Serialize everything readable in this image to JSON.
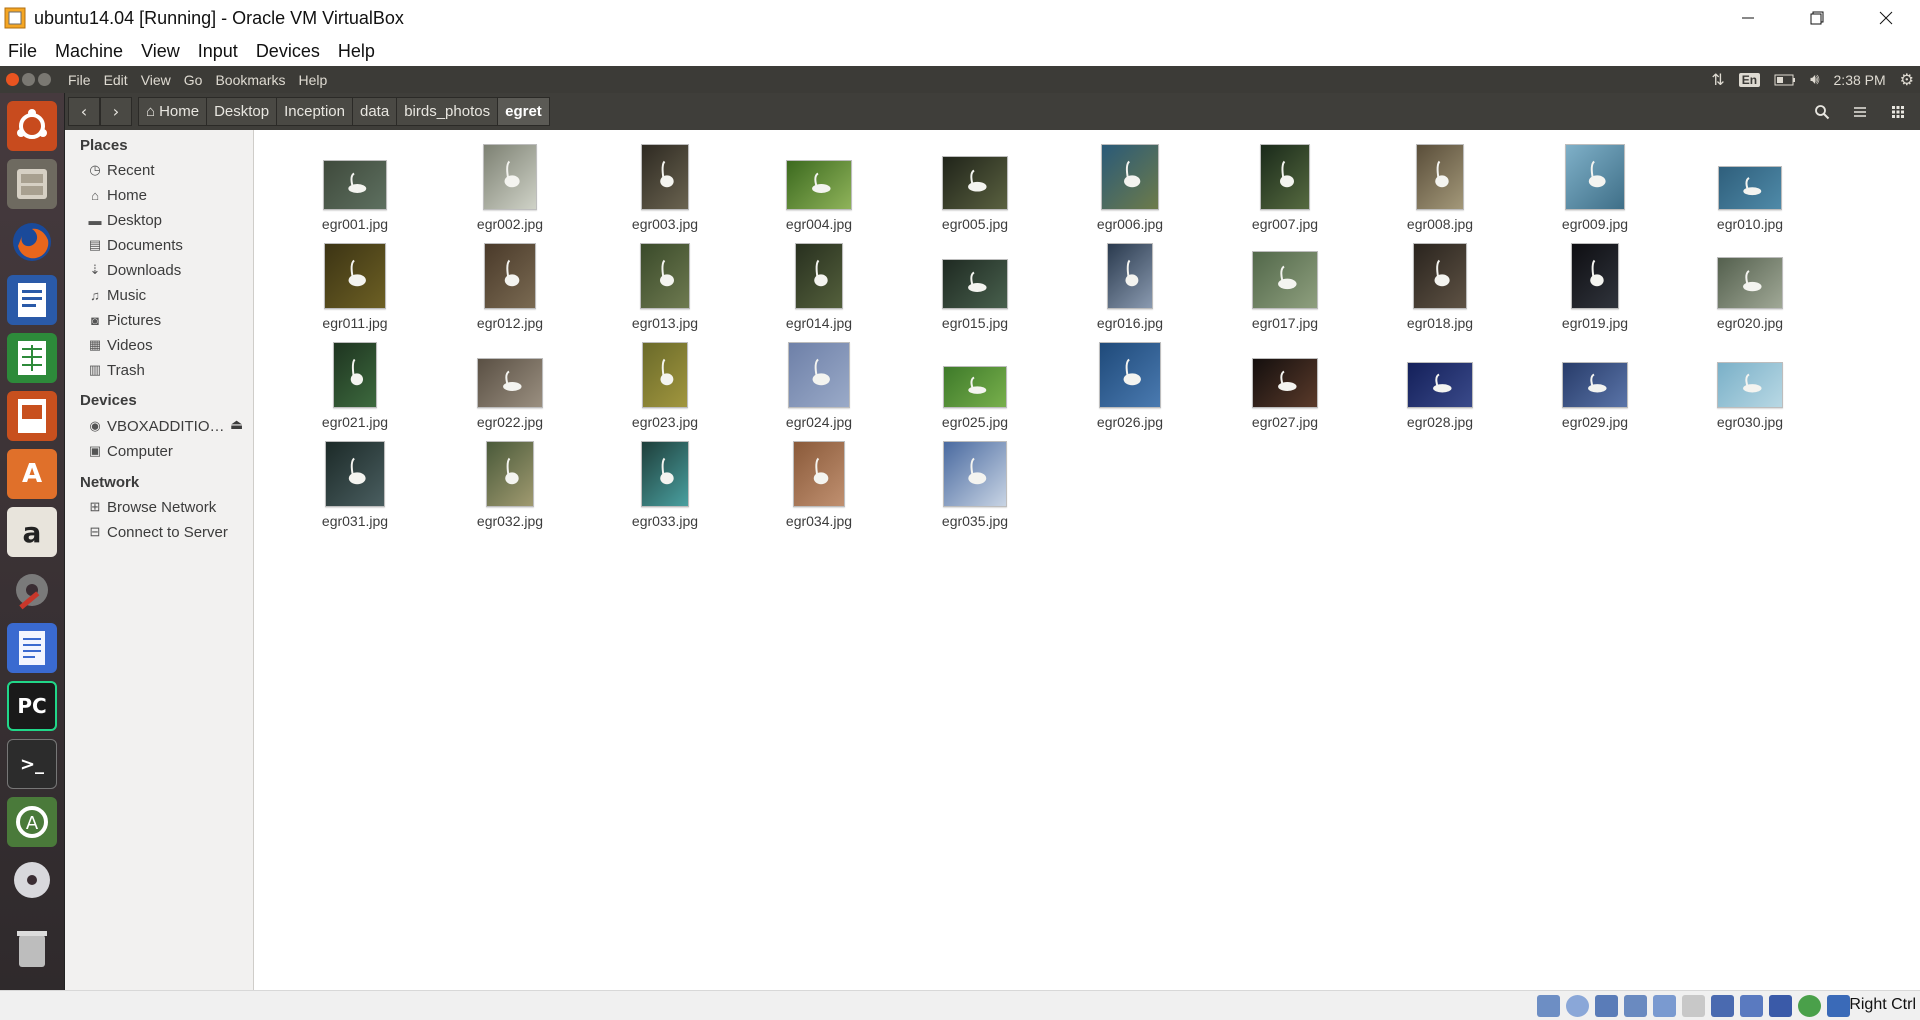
{
  "host_window": {
    "title": "ubuntu14.04 [Running] - Oracle VM VirtualBox",
    "menu": [
      "File",
      "Machine",
      "View",
      "Input",
      "Devices",
      "Help"
    ],
    "status_hostkey": "Right Ctrl"
  },
  "ubuntu_panel": {
    "menu": [
      "File",
      "Edit",
      "View",
      "Go",
      "Bookmarks",
      "Help"
    ],
    "lang": "En",
    "clock": "2:38 PM"
  },
  "breadcrumb": [
    "Home",
    "Desktop",
    "Inception",
    "data",
    "birds_photos",
    "egret"
  ],
  "sidebar": {
    "places_title": "Places",
    "places": [
      {
        "label": "Recent",
        "icon": "clock-icon"
      },
      {
        "label": "Home",
        "icon": "home-icon"
      },
      {
        "label": "Desktop",
        "icon": "folder-icon"
      },
      {
        "label": "Documents",
        "icon": "document-icon"
      },
      {
        "label": "Downloads",
        "icon": "download-icon"
      },
      {
        "label": "Music",
        "icon": "music-icon"
      },
      {
        "label": "Pictures",
        "icon": "camera-icon"
      },
      {
        "label": "Videos",
        "icon": "film-icon"
      },
      {
        "label": "Trash",
        "icon": "trash-icon"
      }
    ],
    "devices_title": "Devices",
    "devices": [
      {
        "label": "VBOXADDITIO…",
        "icon": "disc-icon"
      },
      {
        "label": "Computer",
        "icon": "computer-icon"
      }
    ],
    "network_title": "Network",
    "network": [
      {
        "label": "Browse Network",
        "icon": "network-icon"
      },
      {
        "label": "Connect to Server",
        "icon": "server-icon"
      }
    ]
  },
  "files": [
    {
      "name": "egr001.jpg",
      "c": [
        "#3f4a3c",
        "#5e7060"
      ]
    },
    {
      "name": "egr002.jpg",
      "c": [
        "#7d8173",
        "#cfd2c7"
      ]
    },
    {
      "name": "egr003.jpg",
      "c": [
        "#2e2a22",
        "#6a6350"
      ]
    },
    {
      "name": "egr004.jpg",
      "c": [
        "#3c6a1f",
        "#8fb35a"
      ]
    },
    {
      "name": "egr005.jpg",
      "c": [
        "#20241a",
        "#5a6140"
      ]
    },
    {
      "name": "egr006.jpg",
      "c": [
        "#2a5a78",
        "#6d7b4a"
      ]
    },
    {
      "name": "egr007.jpg",
      "c": [
        "#1a2a1a",
        "#566a40"
      ]
    },
    {
      "name": "egr008.jpg",
      "c": [
        "#5a4e3a",
        "#a39879"
      ]
    },
    {
      "name": "egr009.jpg",
      "c": [
        "#7fb0c8",
        "#3f6f88"
      ]
    },
    {
      "name": "egr010.jpg",
      "c": [
        "#2f5f7c",
        "#4f8aa8"
      ]
    },
    {
      "name": "egr011.jpg",
      "c": [
        "#3c3414",
        "#6d6024"
      ]
    },
    {
      "name": "egr012.jpg",
      "c": [
        "#4a3a2a",
        "#7a6a52"
      ]
    },
    {
      "name": "egr013.jpg",
      "c": [
        "#3a4a2a",
        "#6e7a50"
      ]
    },
    {
      "name": "egr014.jpg",
      "c": [
        "#28301f",
        "#54603c"
      ]
    },
    {
      "name": "egr015.jpg",
      "c": [
        "#1f2a22",
        "#48604d"
      ]
    },
    {
      "name": "egr016.jpg",
      "c": [
        "#2a3a4e",
        "#8a9ab0"
      ]
    },
    {
      "name": "egr017.jpg",
      "c": [
        "#52684a",
        "#8e9f7e"
      ]
    },
    {
      "name": "egr018.jpg",
      "c": [
        "#2a241e",
        "#5e5244"
      ]
    },
    {
      "name": "egr019.jpg",
      "c": [
        "#0e0e12",
        "#30343c"
      ]
    },
    {
      "name": "egr020.jpg",
      "c": [
        "#54604e",
        "#a0a896"
      ]
    },
    {
      "name": "egr021.jpg",
      "c": [
        "#1e3420",
        "#3d6a3e"
      ]
    },
    {
      "name": "egr022.jpg",
      "c": [
        "#5a5044",
        "#9a8f80"
      ]
    },
    {
      "name": "egr023.jpg",
      "c": [
        "#6a6a2a",
        "#a1963e"
      ]
    },
    {
      "name": "egr024.jpg",
      "c": [
        "#6e80a8",
        "#9aaac8"
      ]
    },
    {
      "name": "egr025.jpg",
      "c": [
        "#3e7a2a",
        "#78b04c"
      ]
    },
    {
      "name": "egr026.jpg",
      "c": [
        "#1f4a7a",
        "#4a7ab0"
      ]
    },
    {
      "name": "egr027.jpg",
      "c": [
        "#140f0e",
        "#5a3a2a"
      ]
    },
    {
      "name": "egr028.jpg",
      "c": [
        "#14205a",
        "#3a4a8a"
      ]
    },
    {
      "name": "egr029.jpg",
      "c": [
        "#283c6a",
        "#5a74a8"
      ]
    },
    {
      "name": "egr030.jpg",
      "c": [
        "#7ab0c8",
        "#b8d8e4"
      ]
    },
    {
      "name": "egr031.jpg",
      "c": [
        "#1c2a28",
        "#4a5e60"
      ]
    },
    {
      "name": "egr032.jpg",
      "c": [
        "#4a5a3a",
        "#a09a70"
      ]
    },
    {
      "name": "egr033.jpg",
      "c": [
        "#1e3e3a",
        "#4aa0a0"
      ]
    },
    {
      "name": "egr034.jpg",
      "c": [
        "#8a5a3a",
        "#c09070"
      ]
    },
    {
      "name": "egr035.jpg",
      "c": [
        "#4a6aa0",
        "#c8d4e4"
      ]
    }
  ]
}
